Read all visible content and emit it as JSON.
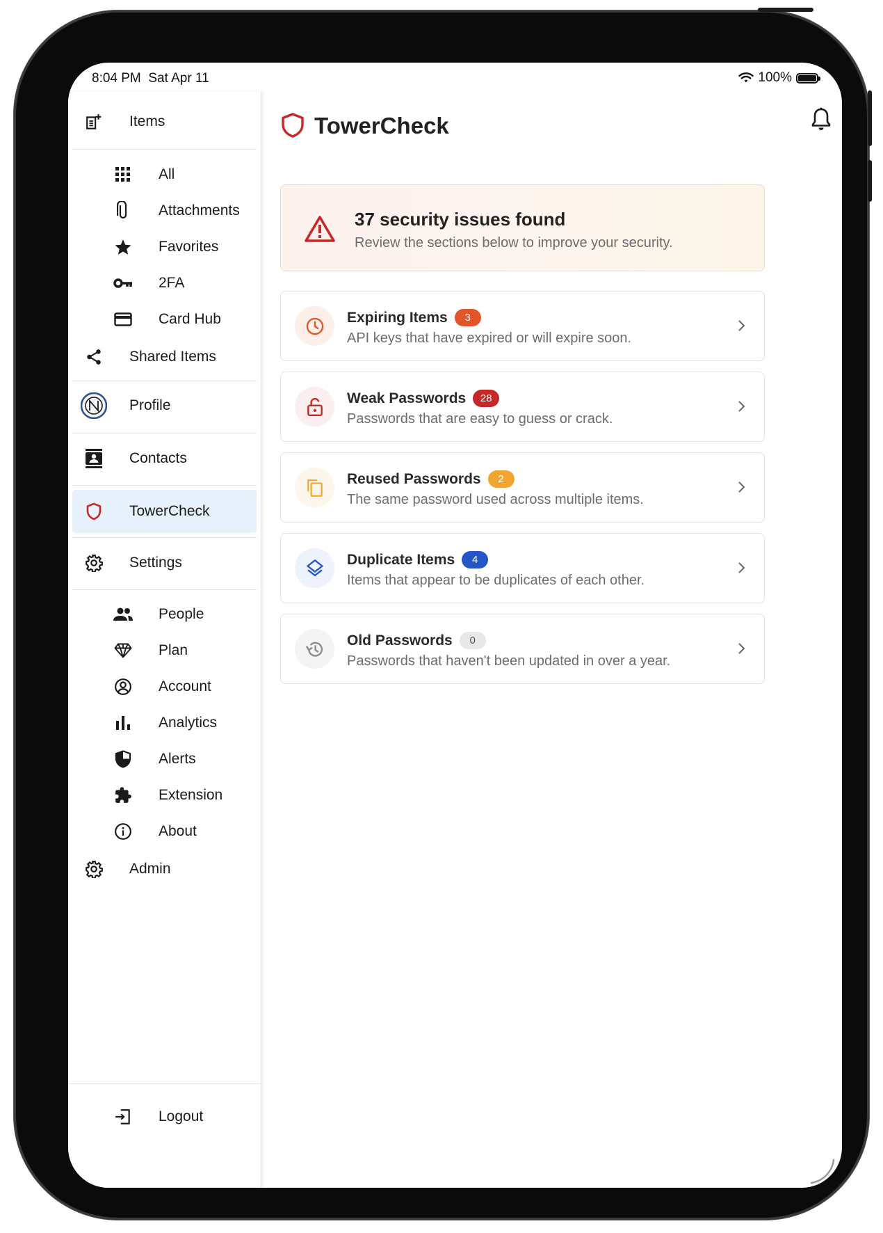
{
  "status": {
    "time": "8:04 PM",
    "date": "Sat Apr 11",
    "battery": "100%",
    "battery_level": 1.0
  },
  "sidebar": {
    "items": {
      "label": "Items",
      "icon": "note-add-icon"
    },
    "all": {
      "label": "All",
      "icon": "grid-icon"
    },
    "attachments": {
      "label": "Attachments",
      "icon": "paperclip-icon"
    },
    "favorites": {
      "label": "Favorites",
      "icon": "star-icon"
    },
    "twofa": {
      "label": "2FA",
      "icon": "key-icon"
    },
    "card_hub": {
      "label": "Card Hub",
      "icon": "credit-card-icon"
    },
    "shared": {
      "label": "Shared Items",
      "icon": "share-icon"
    },
    "profile": {
      "label": "Profile",
      "icon": "avatar-icon"
    },
    "contacts": {
      "label": "Contacts",
      "icon": "contacts-icon"
    },
    "towercheck": {
      "label": "TowerCheck",
      "icon": "shield-icon"
    },
    "settings": {
      "label": "Settings",
      "icon": "gear-icon"
    },
    "people": {
      "label": "People",
      "icon": "people-icon"
    },
    "plan": {
      "label": "Plan",
      "icon": "diamond-icon"
    },
    "account": {
      "label": "Account",
      "icon": "account-circle-icon"
    },
    "analytics": {
      "label": "Analytics",
      "icon": "bar-chart-icon"
    },
    "alerts": {
      "label": "Alerts",
      "icon": "shield-half-icon"
    },
    "extension": {
      "label": "Extension",
      "icon": "puzzle-icon"
    },
    "about": {
      "label": "About",
      "icon": "info-icon"
    },
    "admin": {
      "label": "Admin",
      "icon": "gear-icon"
    },
    "logout": {
      "label": "Logout",
      "icon": "logout-icon"
    }
  },
  "header": {
    "title": "TowerCheck",
    "icon": "shield-icon",
    "bell": "bell-icon"
  },
  "banner": {
    "title": "37 security issues found",
    "text": "Review the sections below to improve your security.",
    "icon": "warning-triangle-icon",
    "color": "#c62828"
  },
  "cards": [
    {
      "title": "Expiring Items",
      "count": "3",
      "text": "API keys that have expired or will expire soon.",
      "icon": "clock-icon",
      "color": "#e0562a",
      "bg": "#fdf0eb"
    },
    {
      "title": "Weak Passwords",
      "count": "28",
      "text": "Passwords that are easy to guess or crack.",
      "icon": "lock-open-icon",
      "color": "#c62828",
      "bg": "#fbeeee"
    },
    {
      "title": "Reused Passwords",
      "count": "2",
      "text": "The same password used across multiple items.",
      "icon": "copy-icon",
      "color": "#f0a530",
      "bg": "#fdf6ea"
    },
    {
      "title": "Duplicate Items",
      "count": "4",
      "text": "Items that appear to be duplicates of each other.",
      "icon": "layers-icon",
      "color": "#2457c5",
      "bg": "#eef2fb"
    },
    {
      "title": "Old Passwords",
      "count": "0",
      "text": "Passwords that haven't been updated in over a year.",
      "icon": "history-icon",
      "color": "#e8e8e8",
      "bg": "#f4f4f4"
    }
  ]
}
